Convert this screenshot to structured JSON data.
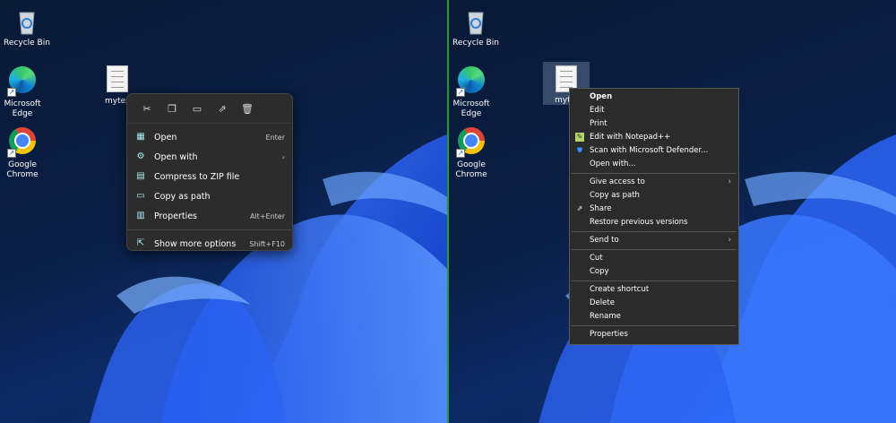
{
  "desktop": {
    "recycle_bin": "Recycle Bin",
    "edge": "Microsoft\nEdge",
    "chrome": "Google\nChrome"
  },
  "left_file_label": "mytex",
  "right_file_label": "myt",
  "win11_menu": {
    "toolbar": [
      {
        "name": "cut-icon",
        "glyph": "✂"
      },
      {
        "name": "copy-icon",
        "glyph": "❐"
      },
      {
        "name": "rename-icon",
        "glyph": "▭"
      },
      {
        "name": "share-icon",
        "glyph": "⇗"
      },
      {
        "name": "delete-icon",
        "glyph": "🗑"
      }
    ],
    "items": [
      {
        "label": "Open",
        "shortcut": "Enter",
        "icon": "▦"
      },
      {
        "label": "Open with",
        "shortcut": "›",
        "icon": "⚙"
      },
      {
        "label": "Compress to ZIP file",
        "shortcut": "",
        "icon": "▤"
      },
      {
        "label": "Copy as path",
        "shortcut": "",
        "icon": "▭"
      },
      {
        "label": "Properties",
        "shortcut": "Alt+Enter",
        "icon": "▥"
      },
      {
        "label": "Show more options",
        "shortcut": "Shift+F10",
        "icon": "⇱"
      }
    ]
  },
  "classic_menu": {
    "items": [
      "Open",
      "Edit",
      "Print",
      "Edit with Notepad++",
      "Scan with Microsoft Defender...",
      "Open with...",
      "Give access to",
      "Copy as path",
      "Share",
      "Restore previous versions",
      "Send to",
      "Cut",
      "Copy",
      "Create shortcut",
      "Delete",
      "Rename",
      "Properties"
    ]
  },
  "colors": {
    "divider": "#1f9c33",
    "menu_bg": "#2b2b2b"
  }
}
